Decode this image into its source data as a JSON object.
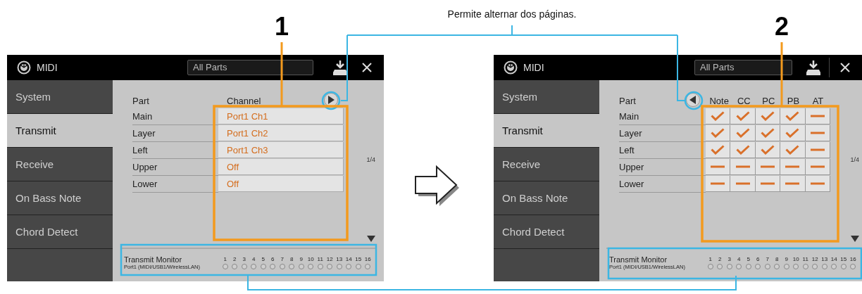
{
  "caption": "Permite alternar dos páginas.",
  "screens": [
    {
      "kind": "channel",
      "callout": "1",
      "title": "MIDI",
      "filter": "All Parts",
      "tabs": [
        {
          "label": "System",
          "selected": false
        },
        {
          "label": "Transmit",
          "selected": true
        },
        {
          "label": "Receive",
          "selected": false
        },
        {
          "label": "On Bass Note",
          "selected": false
        },
        {
          "label": "Chord Detect",
          "selected": false
        }
      ],
      "columns": [
        "Part",
        "Channel"
      ],
      "rows": [
        {
          "part": "Main",
          "value": "Port1 Ch1"
        },
        {
          "part": "Layer",
          "value": "Port1 Ch2"
        },
        {
          "part": "Left",
          "value": "Port1 Ch3"
        },
        {
          "part": "Upper",
          "value": "Off"
        },
        {
          "part": "Lower",
          "value": "Off"
        }
      ],
      "page": "1/4",
      "monitor": {
        "title": "Transmit Monitor",
        "port": "Port1 (MIDI/USB1/WirelessLAN)",
        "channels": [
          "1",
          "2",
          "3",
          "4",
          "5",
          "6",
          "7",
          "8",
          "9",
          "10",
          "11",
          "12",
          "13",
          "14",
          "15",
          "16"
        ]
      }
    },
    {
      "kind": "filter",
      "callout": "2",
      "title": "MIDI",
      "filter": "All Parts",
      "tabs": [
        {
          "label": "System",
          "selected": false
        },
        {
          "label": "Transmit",
          "selected": true
        },
        {
          "label": "Receive",
          "selected": false
        },
        {
          "label": "On Bass Note",
          "selected": false
        },
        {
          "label": "Chord Detect",
          "selected": false
        }
      ],
      "columns": [
        "Part",
        "Note",
        "CC",
        "PC",
        "PB",
        "AT"
      ],
      "rows": [
        {
          "part": "Main",
          "values": [
            true,
            true,
            true,
            true,
            false
          ]
        },
        {
          "part": "Layer",
          "values": [
            true,
            true,
            true,
            true,
            false
          ]
        },
        {
          "part": "Left",
          "values": [
            true,
            true,
            true,
            true,
            false
          ]
        },
        {
          "part": "Upper",
          "values": [
            false,
            false,
            false,
            false,
            false
          ]
        },
        {
          "part": "Lower",
          "values": [
            false,
            false,
            false,
            false,
            false
          ]
        }
      ],
      "page": "1/4",
      "monitor": {
        "title": "Transmit Monitor",
        "port": "Port1 (MIDI/USB1/WirelessLAN)",
        "channels": [
          "1",
          "2",
          "3",
          "4",
          "5",
          "6",
          "7",
          "8",
          "9",
          "10",
          "11",
          "12",
          "13",
          "14",
          "15",
          "16"
        ]
      }
    }
  ]
}
